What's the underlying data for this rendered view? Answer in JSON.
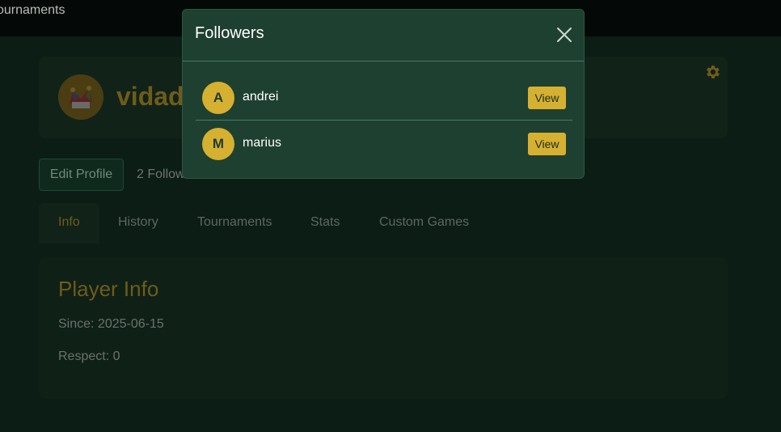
{
  "topbar": {
    "nav_partial": "ournaments"
  },
  "profile": {
    "username_partial": "vidad",
    "edit_button": "Edit Profile",
    "follow_stats_partial": "2 Follow"
  },
  "tabs": [
    {
      "label": "Info",
      "active": true
    },
    {
      "label": "History",
      "active": false
    },
    {
      "label": "Tournaments",
      "active": false
    },
    {
      "label": "Stats",
      "active": false
    },
    {
      "label": "Custom Games",
      "active": false
    }
  ],
  "player_info": {
    "title": "Player Info",
    "since": "Since: 2025-06-15",
    "respect": "Respect: 0"
  },
  "modal": {
    "title": "Followers",
    "close_icon": "close-icon",
    "followers": [
      {
        "initial": "A",
        "name": "andrei",
        "button": "View"
      },
      {
        "initial": "M",
        "name": "marius",
        "button": "View"
      }
    ]
  },
  "colors": {
    "accent": "#d6b030",
    "modal_bg": "#1e4030",
    "page_bg": "#0b1d14"
  }
}
